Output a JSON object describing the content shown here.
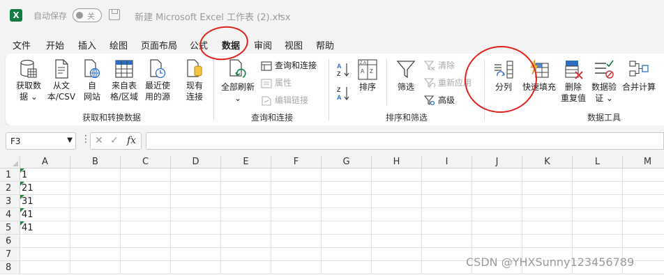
{
  "titlebar": {
    "app_icon": "X",
    "autosave_label": "自动保存",
    "autosave_state": "关",
    "filename": "新建 Microsoft Excel 工作表 (2).xlsx",
    "filename_chevron": "⌄"
  },
  "menu": {
    "tabs": [
      "文件",
      "开始",
      "插入",
      "绘图",
      "页面布局",
      "公式",
      "数据",
      "审阅",
      "视图",
      "帮助"
    ],
    "active": "数据"
  },
  "ribbon": {
    "get_data": {
      "label_get_data_1": "获取数",
      "label_get_data_2": "据 ⌄",
      "label_from_text_1": "从文",
      "label_from_text_2": "本/CSV",
      "label_from_web_1": "自",
      "label_from_web_2": "网站",
      "label_from_table_1": "来自表",
      "label_from_table_2": "格/区域",
      "label_recent_1": "最近使",
      "label_recent_2": "用的源",
      "label_existing_1": "现有",
      "label_existing_2": "连接",
      "group_label": "获取和转换数据"
    },
    "queries": {
      "refresh_all_1": "全部刷新",
      "refresh_all_2": "⌄",
      "queries_connections": "查询和连接",
      "properties": "属性",
      "edit_links": "编辑链接",
      "group_label": "查询和连接"
    },
    "sort_filter": {
      "sort": "排序",
      "filter": "筛选",
      "clear": "清除",
      "reapply": "重新应用",
      "advanced": "高级",
      "group_label": "排序和筛选"
    },
    "data_tools": {
      "text_to_columns": "分列",
      "flash_fill": "快速填充",
      "remove_dup_1": "删除",
      "remove_dup_2": "重复值",
      "validation_1": "数据验",
      "validation_2": "证 ⌄",
      "consolidate": "合并计算",
      "group_label": "数据工具"
    },
    "icons": [
      "database-icon",
      "text-file-icon",
      "web-icon",
      "table-icon",
      "recent-sources-icon",
      "existing-connections-icon",
      "refresh-icon",
      "queries-icon",
      "properties-icon",
      "edit-links-icon",
      "sort-az-icon",
      "sort-za-icon",
      "sort-icon",
      "filter-icon",
      "clear-icon",
      "reapply-icon",
      "advanced-icon",
      "split-columns-icon",
      "flash-fill-icon",
      "remove-duplicates-icon",
      "data-validation-icon",
      "consolidate-icon"
    ]
  },
  "formula_bar": {
    "name_box": "F3",
    "fx": "fx",
    "formula": ""
  },
  "sheet": {
    "columns": [
      "A",
      "B",
      "C",
      "D",
      "E",
      "F",
      "G",
      "H",
      "I",
      "J",
      "K",
      "L",
      "M"
    ],
    "rows": [
      "1",
      "2",
      "3",
      "4",
      "5",
      "6",
      "7",
      "8"
    ],
    "column_a": [
      "1",
      "21",
      "31",
      "41",
      "41",
      "",
      "",
      ""
    ]
  },
  "colors": {
    "accent": "#107c41",
    "annotation": "#e0221c",
    "ribbon_bg": "#ffffff",
    "chrome_bg": "#f3f3f3"
  },
  "watermark": "CSDN @YHXSunny123456789"
}
